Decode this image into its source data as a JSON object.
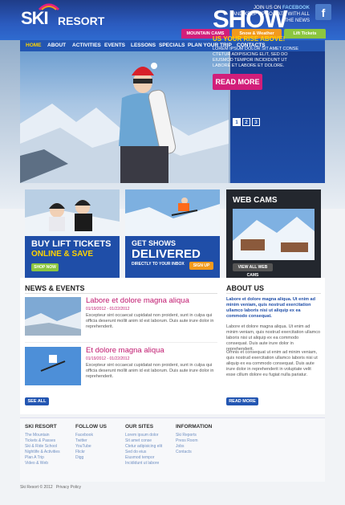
{
  "header": {
    "logo_ski": "SKI",
    "logo_resort": "RESORT",
    "join_line1_prefix": "JOIN US ON",
    "join_line1_brand": "FACEBOOK",
    "join_line2": "AND KEEP UP TO DATE WITH ALL THE NEWS",
    "fb_icon": "f",
    "tabs": [
      {
        "label": "MOUNTAIN CAMS",
        "color": "#d21e7a"
      },
      {
        "label": "Snow & Weather",
        "color": "#f29a1c"
      },
      {
        "label": "Lift Tickets",
        "color": "#8cc63f"
      }
    ]
  },
  "nav": {
    "items": [
      "HOME",
      "ABOUT",
      "ACTIVITIES",
      "EVENTS",
      "LESSONS",
      "SPECIALS",
      "PLAN YOUR TRIP",
      "CONTACTS"
    ],
    "active": "HOME"
  },
  "hero": {
    "headline": "SHOW",
    "subhead": "US YOUR RISE ABOVE!",
    "text": "LOREM IPSUM DOLOR SIT AMET CONSE CTETUR ADIPISICING ELIT, SED DO EIUSMOD TEMPOR INCIDIDUNT UT LABORE ET LABORE ET DOLORE.",
    "button": "READ MORE",
    "pages": [
      "1",
      "2",
      "3"
    ],
    "active_page": "1"
  },
  "promos": [
    {
      "title_line1": "BUY LIFT TICKETS",
      "title_line2": "ONLINE & SAVE",
      "button": "SHOP NOW"
    },
    {
      "title_line1": "GET SHOWS",
      "title_line2": "DELIVERED",
      "title_line3": "DIRECTLY TO YOUR INBOX",
      "button": "SIGN UP"
    },
    {
      "title_line1": "WEB CAMS",
      "button": "VIEW ALL WEB CAMS"
    }
  ],
  "news": {
    "heading": "NEWS & EVENTS",
    "items": [
      {
        "title": "Labore et dolore magna aliqua",
        "date": "01/19/2012 - 01/22/2012",
        "text": "Excepteur sint occaecat cupidatat non proident, sunt in culpa qui officia deserunt mollit anim id est laborum. Duis aute irure dolor in reprehenderit."
      },
      {
        "title": "Et dolore magna aliqua",
        "date": "01/19/2012 - 01/22/2012",
        "text": "Excepteur sint occaecat cupidatat non proident, sunt in culpa qui officia deserunt mollit anim id est laborum. Duis aute irure dolor in reprehenderit."
      }
    ],
    "see_all": "SEE ALL"
  },
  "about": {
    "heading": "ABOUT US",
    "intro": "Labore et dolore magna aliqua. Ut enim ad minim veniam, quis nostrud exercitation ullamco laboris nisi ut aliquip ex ea commodo consequat.",
    "p1": "Labore et dolore magna aliqua. Ut enim ad minim veniam, quis nostrud exercitation ullamco laboris nisi ut aliquip ex ea commodo consequat. Duis aute irure dolor in reprehenderit.",
    "p2": "Omnis et consequat ut enim ad minim veniam, quis nostrud exercitation ullamco laboris nisi ut aliquip ex ea commodo consequat. Duis aute irure dolor in reprehenderit in voluptate velit esse cillum dolore eu fugiat nulla pariatur.",
    "button": "READ MORE"
  },
  "footer": {
    "columns": [
      {
        "heading": "SKI RESORT",
        "links": [
          "The Mountain",
          "Tickets & Passes",
          "Ski & Ride School",
          "Nightlife & Activities",
          "Plan A Trip",
          "Video & Web"
        ]
      },
      {
        "heading": "FOLLOW US",
        "links": [
          "Facebook",
          "Twitter",
          "YouTube",
          "Flickr",
          "Digg"
        ]
      },
      {
        "heading": "OUR SITES",
        "links": [
          "Lorem ipsum dolor",
          "Sit amet conse",
          "Ctetur adipisicing elit",
          "Sed do eius",
          "Eiusmod tempor",
          "Incididunt ut labore"
        ]
      },
      {
        "heading": "INFORMATION",
        "links": [
          "Ski Reports",
          "Press Room",
          "Jobs",
          "Contacts"
        ]
      }
    ],
    "copyright": "Ski Resort © 2012",
    "privacy": "Privacy Policy"
  }
}
